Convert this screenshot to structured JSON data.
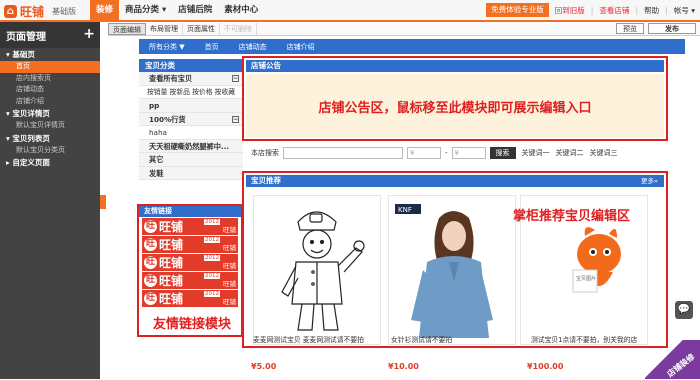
{
  "brand": {
    "logo_text": "旺铺",
    "edition": "基础版"
  },
  "nav": [
    {
      "label": "装修",
      "active": true
    },
    {
      "label": "商品分类 ▾",
      "active": false
    },
    {
      "label": "店铺后院",
      "active": false
    },
    {
      "label": "素材中心",
      "active": false
    }
  ],
  "top_actions": {
    "trial": "免费体验专业版",
    "back": "回到旧版",
    "view_shop": "查看店铺",
    "help": "帮助",
    "account": "帐号 ▾"
  },
  "sidebar": {
    "title": "页面管理",
    "add": "+",
    "groups": [
      {
        "label": "基础页",
        "items": [
          {
            "label": "首页",
            "active": true
          },
          {
            "label": "店内搜索页"
          },
          {
            "label": "店铺动态"
          },
          {
            "label": "店铺介绍"
          }
        ]
      },
      {
        "label": "宝贝详情页",
        "items": [
          {
            "label": "默认宝贝详情页"
          }
        ]
      },
      {
        "label": "宝贝列表页",
        "items": [
          {
            "label": "默认宝贝分类页"
          }
        ]
      },
      {
        "label": "自定义页面",
        "items": []
      }
    ]
  },
  "toolbar": {
    "tabs": [
      {
        "label": "页面编辑",
        "active": true
      },
      {
        "label": "布局管理"
      },
      {
        "label": "页面属性"
      },
      {
        "label": "不可删除",
        "disabled": true
      }
    ],
    "preview": "预览",
    "publish": "发布"
  },
  "shopnav": [
    "所有分类 ▼",
    "首页",
    "店铺动态",
    "店铺介绍"
  ],
  "categories": {
    "title": "宝贝分类",
    "rows": [
      {
        "label": "查看所有宝贝",
        "bold": true,
        "expand": true
      },
      {
        "label": "按销量 按新品 按价格 按收藏"
      },
      {
        "label": "pp",
        "bold": true
      },
      {
        "label": "100%行货",
        "bold": true,
        "expand": true
      },
      {
        "label": "haha"
      },
      {
        "label": "天天祖硬嘶奶然腿裤中...",
        "bold": true
      },
      {
        "label": "其它",
        "bold": true
      },
      {
        "label": "发鞋",
        "bold": true
      }
    ]
  },
  "links": {
    "title": "友情链接",
    "badge_name": "旺铺",
    "badge_year": "2012",
    "badge_mini": "旺铺",
    "count": 5,
    "overlay": "友情链接模块"
  },
  "notice": {
    "title": "店铺公告",
    "overlay": "店铺公告区，鼠标移至此模块即可展示编辑入口"
  },
  "search": {
    "label": "本店搜索",
    "price_from": "¥",
    "price_to": "¥",
    "button": "搜索",
    "keywords": [
      "关键词一",
      "关键词二",
      "关键词三"
    ]
  },
  "reco": {
    "title": "宝贝推荐",
    "more": "更多»",
    "overlay": "掌柜推荐宝贝编辑区"
  },
  "products": [
    {
      "name": "麦麦网测试宝贝 麦麦网测试请不要拍",
      "price": "¥5.00"
    },
    {
      "name": "女针衫测试请不要拍",
      "price": "¥10.00"
    },
    {
      "name": "测试宝贝1点请不要拍，别关我的店",
      "price": "¥100.00"
    }
  ],
  "corner_badge": "店铺装修"
}
